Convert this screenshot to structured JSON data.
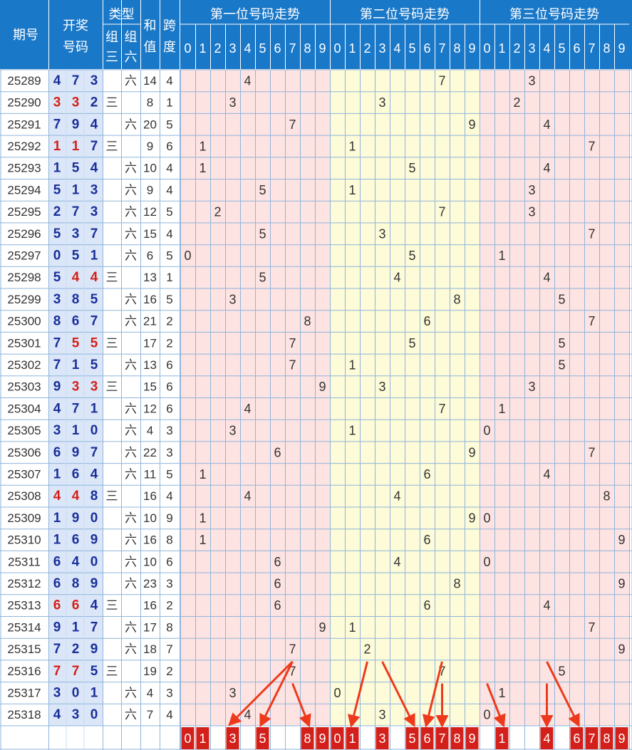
{
  "header": {
    "period": "期号",
    "draw": [
      "开奖",
      "号码"
    ],
    "type": "类型",
    "type_z3": [
      "组",
      "三"
    ],
    "type_z6": [
      "组",
      "六"
    ],
    "sum": [
      "和",
      "值"
    ],
    "span": [
      "跨",
      "度"
    ],
    "pos_titles": [
      "第一位号码走势",
      "第二位号码走势",
      "第三位号码走势"
    ],
    "digits": [
      "0",
      "1",
      "2",
      "3",
      "4",
      "5",
      "6",
      "7",
      "8",
      "9"
    ]
  },
  "type_labels": {
    "z3": "三",
    "z6": "六"
  },
  "colors": {
    "header_bg": "#1a78c8",
    "header_text": "#ffffff",
    "period_text": "#333333",
    "draw_blue": "#1a2f9a",
    "draw_red": "#d4201a",
    "draw_bg": "#dbe7f8",
    "pos1_bg": "#fde3e1",
    "pos2_bg": "#fdfbd8",
    "pos3_bg": "#fde3e1",
    "grid_line": "#8fb5dc",
    "digit_text": "#333333",
    "forecast_bg": "#d4201a",
    "forecast_text": "#ffffff",
    "arrow": "#ee3a1c"
  },
  "chart_data": {
    "type": "table",
    "rows": [
      {
        "period": "25289",
        "draw": [
          "4",
          "7",
          "3"
        ],
        "pair_highlight": [],
        "group_type": "六",
        "sum": "14",
        "span": "4"
      },
      {
        "period": "25290",
        "draw": [
          "3",
          "3",
          "2"
        ],
        "pair_highlight": [
          0,
          1
        ],
        "group_type": "三",
        "sum": "8",
        "span": "1"
      },
      {
        "period": "25291",
        "draw": [
          "7",
          "9",
          "4"
        ],
        "pair_highlight": [],
        "group_type": "六",
        "sum": "20",
        "span": "5"
      },
      {
        "period": "25292",
        "draw": [
          "1",
          "1",
          "7"
        ],
        "pair_highlight": [
          0,
          1
        ],
        "group_type": "三",
        "sum": "9",
        "span": "6"
      },
      {
        "period": "25293",
        "draw": [
          "1",
          "5",
          "4"
        ],
        "pair_highlight": [],
        "group_type": "六",
        "sum": "10",
        "span": "4"
      },
      {
        "period": "25294",
        "draw": [
          "5",
          "1",
          "3"
        ],
        "pair_highlight": [],
        "group_type": "六",
        "sum": "9",
        "span": "4"
      },
      {
        "period": "25295",
        "draw": [
          "2",
          "7",
          "3"
        ],
        "pair_highlight": [],
        "group_type": "六",
        "sum": "12",
        "span": "5"
      },
      {
        "period": "25296",
        "draw": [
          "5",
          "3",
          "7"
        ],
        "pair_highlight": [],
        "group_type": "六",
        "sum": "15",
        "span": "4"
      },
      {
        "period": "25297",
        "draw": [
          "0",
          "5",
          "1"
        ],
        "pair_highlight": [],
        "group_type": "六",
        "sum": "6",
        "span": "5"
      },
      {
        "period": "25298",
        "draw": [
          "5",
          "4",
          "4"
        ],
        "pair_highlight": [
          1,
          2
        ],
        "group_type": "三",
        "sum": "13",
        "span": "1"
      },
      {
        "period": "25299",
        "draw": [
          "3",
          "8",
          "5"
        ],
        "pair_highlight": [],
        "group_type": "六",
        "sum": "16",
        "span": "5"
      },
      {
        "period": "25300",
        "draw": [
          "8",
          "6",
          "7"
        ],
        "pair_highlight": [],
        "group_type": "六",
        "sum": "21",
        "span": "2"
      },
      {
        "period": "25301",
        "draw": [
          "7",
          "5",
          "5"
        ],
        "pair_highlight": [
          1,
          2
        ],
        "group_type": "三",
        "sum": "17",
        "span": "2"
      },
      {
        "period": "25302",
        "draw": [
          "7",
          "1",
          "5"
        ],
        "pair_highlight": [],
        "group_type": "六",
        "sum": "13",
        "span": "6"
      },
      {
        "period": "25303",
        "draw": [
          "9",
          "3",
          "3"
        ],
        "pair_highlight": [
          1,
          2
        ],
        "group_type": "三",
        "sum": "15",
        "span": "6"
      },
      {
        "period": "25304",
        "draw": [
          "4",
          "7",
          "1"
        ],
        "pair_highlight": [],
        "group_type": "六",
        "sum": "12",
        "span": "6"
      },
      {
        "period": "25305",
        "draw": [
          "3",
          "1",
          "0"
        ],
        "pair_highlight": [],
        "group_type": "六",
        "sum": "4",
        "span": "3"
      },
      {
        "period": "25306",
        "draw": [
          "6",
          "9",
          "7"
        ],
        "pair_highlight": [],
        "group_type": "六",
        "sum": "22",
        "span": "3"
      },
      {
        "period": "25307",
        "draw": [
          "1",
          "6",
          "4"
        ],
        "pair_highlight": [],
        "group_type": "六",
        "sum": "11",
        "span": "5"
      },
      {
        "period": "25308",
        "draw": [
          "4",
          "4",
          "8"
        ],
        "pair_highlight": [
          0,
          1
        ],
        "group_type": "三",
        "sum": "16",
        "span": "4"
      },
      {
        "period": "25309",
        "draw": [
          "1",
          "9",
          "0"
        ],
        "pair_highlight": [],
        "group_type": "六",
        "sum": "10",
        "span": "9"
      },
      {
        "period": "25310",
        "draw": [
          "1",
          "6",
          "9"
        ],
        "pair_highlight": [],
        "group_type": "六",
        "sum": "16",
        "span": "8"
      },
      {
        "period": "25311",
        "draw": [
          "6",
          "4",
          "0"
        ],
        "pair_highlight": [],
        "group_type": "六",
        "sum": "10",
        "span": "6"
      },
      {
        "period": "25312",
        "draw": [
          "6",
          "8",
          "9"
        ],
        "pair_highlight": [],
        "group_type": "六",
        "sum": "23",
        "span": "3"
      },
      {
        "period": "25313",
        "draw": [
          "6",
          "6",
          "4"
        ],
        "pair_highlight": [
          0,
          1
        ],
        "group_type": "三",
        "sum": "16",
        "span": "2"
      },
      {
        "period": "25314",
        "draw": [
          "9",
          "1",
          "7"
        ],
        "pair_highlight": [],
        "group_type": "六",
        "sum": "17",
        "span": "8"
      },
      {
        "period": "25315",
        "draw": [
          "7",
          "2",
          "9"
        ],
        "pair_highlight": [],
        "group_type": "六",
        "sum": "18",
        "span": "7"
      },
      {
        "period": "25316",
        "draw": [
          "7",
          "7",
          "5"
        ],
        "pair_highlight": [
          0,
          1
        ],
        "group_type": "三",
        "sum": "19",
        "span": "2"
      },
      {
        "period": "25317",
        "draw": [
          "3",
          "0",
          "1"
        ],
        "pair_highlight": [],
        "group_type": "六",
        "sum": "4",
        "span": "3"
      },
      {
        "period": "25318",
        "draw": [
          "4",
          "3",
          "0"
        ],
        "pair_highlight": [],
        "group_type": "六",
        "sum": "7",
        "span": "4"
      }
    ],
    "forecast": [
      [
        "0",
        "1",
        "3",
        "5",
        "8",
        "9"
      ],
      [
        "0",
        "1",
        "3",
        "5",
        "6",
        "7",
        "8",
        "9"
      ],
      [
        "1",
        "4",
        "6",
        "7",
        "8",
        "9"
      ]
    ],
    "arrows": [
      {
        "pos": 0,
        "from_row": 27,
        "from_digit": 7,
        "to_digit": 3
      },
      {
        "pos": 0,
        "from_row": 27,
        "from_digit": 7,
        "to_digit": 5
      },
      {
        "pos": 0,
        "from_row": 28,
        "from_digit": 7,
        "to_digit": 8
      },
      {
        "pos": 1,
        "from_row": 27,
        "from_digit": 2,
        "to_digit": 1
      },
      {
        "pos": 1,
        "from_row": 27,
        "from_digit": 3,
        "to_digit": 5
      },
      {
        "pos": 1,
        "from_row": 27,
        "from_digit": 7,
        "to_digit": 6
      },
      {
        "pos": 1,
        "from_row": 28,
        "from_digit": 7,
        "to_digit": 7
      },
      {
        "pos": 2,
        "from_row": 28,
        "from_digit": 0,
        "to_digit": 1
      },
      {
        "pos": 2,
        "from_row": 28,
        "from_digit": 4,
        "to_digit": 4
      },
      {
        "pos": 2,
        "from_row": 27,
        "from_digit": 4,
        "to_digit": 6
      }
    ]
  }
}
